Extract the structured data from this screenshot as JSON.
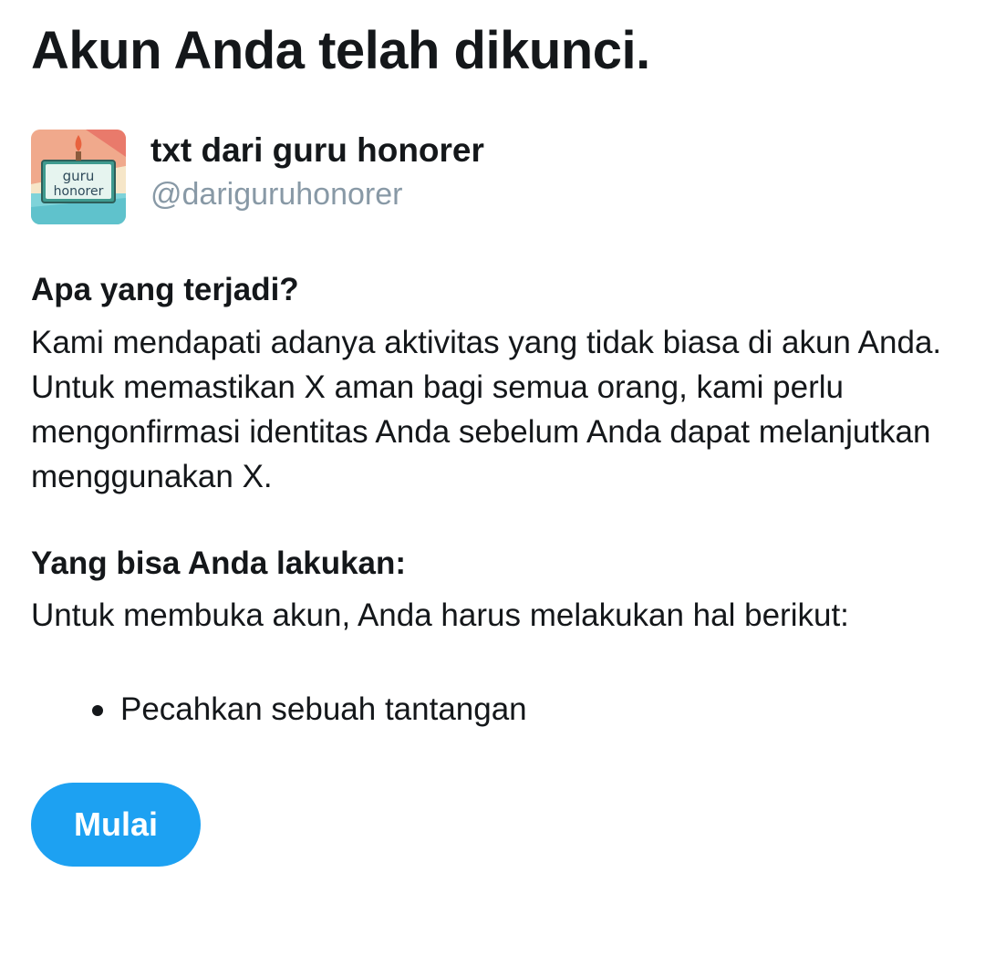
{
  "title": "Akun Anda telah dikunci.",
  "account": {
    "display_name": "txt dari guru honorer",
    "handle": "@dariguruhonorer",
    "avatar_text_line1": "guru",
    "avatar_text_line2": "honorer"
  },
  "what_happened": {
    "heading": "Apa yang terjadi?",
    "body": "Kami mendapati adanya aktivitas yang tidak biasa di akun Anda. Untuk memastikan X aman bagi semua orang, kami perlu mengonfirmasi identitas Anda sebelum Anda dapat melanjutkan menggunakan X."
  },
  "what_you_can_do": {
    "heading": "Yang bisa Anda lakukan:",
    "body": "Untuk membuka akun, Anda harus melakukan hal berikut:",
    "steps": [
      "Pecahkan sebuah tantangan"
    ]
  },
  "start_button_label": "Mulai",
  "colors": {
    "accent": "#1da1f2",
    "text": "#14171a",
    "secondary_text": "#8899a6"
  }
}
